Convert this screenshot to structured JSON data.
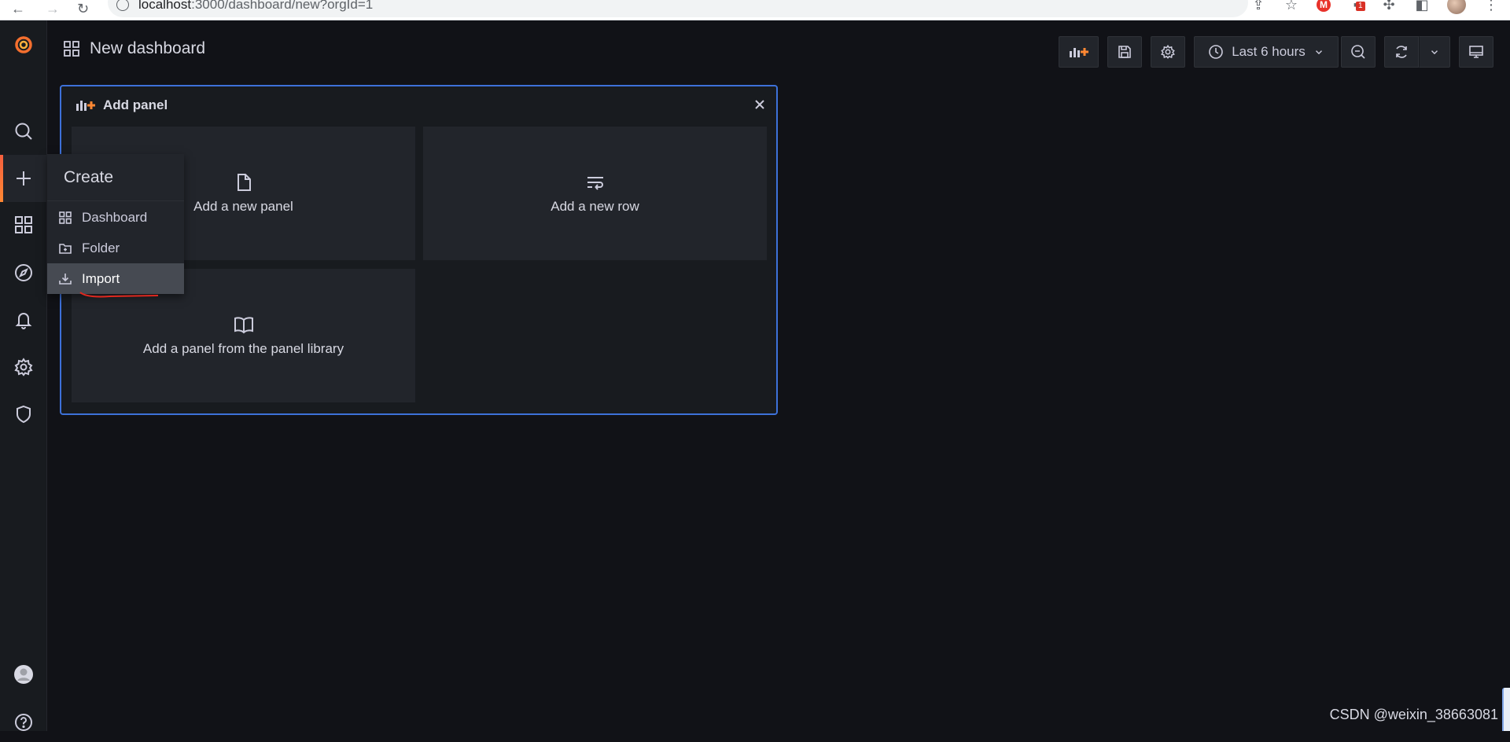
{
  "browser": {
    "url_host": "localhost",
    "url_rest": ":3000/dashboard/new?orgId=1",
    "extension_badge": "1"
  },
  "header": {
    "title": "New dashboard",
    "time_range": "Last 6 hours"
  },
  "create_menu": {
    "heading": "Create",
    "items": [
      {
        "label": "Dashboard",
        "icon": "apps-icon"
      },
      {
        "label": "Folder",
        "icon": "folder-plus-icon"
      },
      {
        "label": "Import",
        "icon": "import-icon"
      }
    ]
  },
  "add_panel": {
    "title": "Add panel",
    "options": [
      {
        "label": "Add a new panel",
        "icon": "file-blank-icon"
      },
      {
        "label": "Add a new row",
        "icon": "wrap-text-icon"
      },
      {
        "label": "Add a panel from the panel library",
        "icon": "book-open-icon"
      }
    ]
  },
  "watermark": "CSDN @weixin_38663081",
  "colors": {
    "background": "#111217",
    "panel_border": "#3d71d9",
    "accent": "#ff8833",
    "card": "#22252b"
  }
}
